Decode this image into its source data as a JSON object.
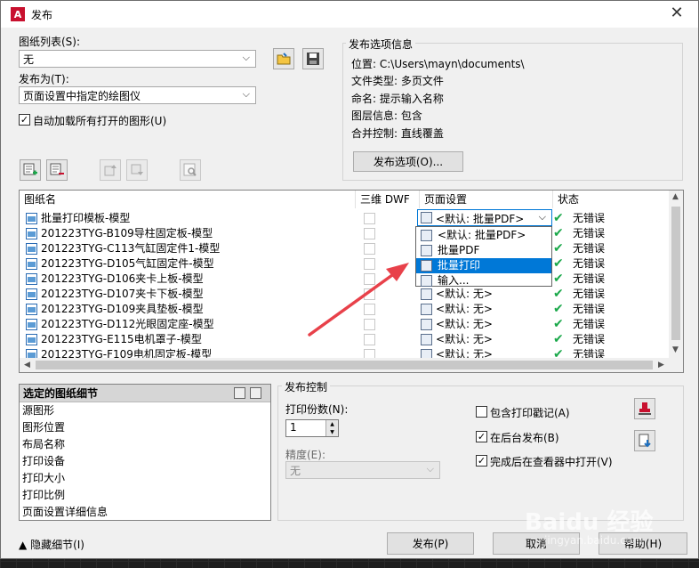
{
  "window": {
    "title": "发布",
    "close": "✕",
    "app_icon_letter": "A"
  },
  "sheet_list": {
    "label": "图纸列表(S):",
    "value": "无"
  },
  "publish_to": {
    "label": "发布为(T):",
    "value": "页面设置中指定的绘图仪"
  },
  "auto_load": {
    "label": "自动加载所有打开的图形(U)",
    "checked": true
  },
  "info": {
    "group_title": "发布选项信息",
    "location": "位置: C:\\Users\\mayn\\documents\\",
    "file_type": "文件类型: 多页文件",
    "naming": "命名: 提示输入名称",
    "layer_info": "图层信息: 包含",
    "merge": "合并控制: 直线覆盖",
    "options_button": "发布选项(O)..."
  },
  "table": {
    "headers": {
      "name": "图纸名",
      "dwf3d": "三维 DWF",
      "page_setup": "页面设置",
      "status": "状态"
    },
    "rows": [
      {
        "name": "批量打印模板-模型",
        "page_setup": "<默认: 批量PDF>",
        "status": "无错误"
      },
      {
        "name": "201223TYG-B109导柱固定板-模型",
        "page_setup": "",
        "status": "无错误"
      },
      {
        "name": "201223TYG-C113气缸固定件1-模型",
        "page_setup": "",
        "status": "无错误"
      },
      {
        "name": "201223TYG-D105气缸固定件-模型",
        "page_setup": "",
        "status": "无错误"
      },
      {
        "name": "201223TYG-D106夹卡上板-模型",
        "page_setup": "",
        "status": "无错误"
      },
      {
        "name": "201223TYG-D107夹卡下板-模型",
        "page_setup": "<默认: 无>",
        "status": "无错误"
      },
      {
        "name": "201223TYG-D109夹具垫板-模型",
        "page_setup": "<默认: 无>",
        "status": "无错误"
      },
      {
        "name": "201223TYG-D112光眼固定座-模型",
        "page_setup": "<默认: 无>",
        "status": "无错误"
      },
      {
        "name": "201223TYG-E115电机罩子-模型",
        "page_setup": "<默认: 无>",
        "status": "无错误"
      },
      {
        "name": "201223TYG-F109电机固定板-模型",
        "page_setup": "<默认: 无>",
        "status": "无错误"
      }
    ],
    "dropdown_options": [
      "<默认: 批量PDF>",
      "批量PDF",
      "批量打印",
      "输入..."
    ],
    "dropdown_selected": "批量打印"
  },
  "details": {
    "title": "选定的图纸细节",
    "items": [
      "源图形",
      "图形位置",
      "布局名称",
      "打印设备",
      "打印大小",
      "打印比例",
      "页面设置详细信息"
    ]
  },
  "publish_control": {
    "group_title": "发布控制",
    "copies_label": "打印份数(N):",
    "copies_value": "1",
    "precision_label": "精度(E):",
    "precision_value": "无",
    "include_stamp": {
      "label": "包含打印戳记(A)",
      "checked": false
    },
    "background": {
      "label": "在后台发布(B)",
      "checked": true
    },
    "open_viewer": {
      "label": "完成后在查看器中打开(V)",
      "checked": true
    }
  },
  "footer": {
    "hide_details": "隐藏细节(I)",
    "publish": "发布(P)",
    "cancel": "取消",
    "help": "帮助(H)"
  },
  "watermark": {
    "main": "Baidu 经验",
    "sub": "jingyan.baidu.com"
  }
}
